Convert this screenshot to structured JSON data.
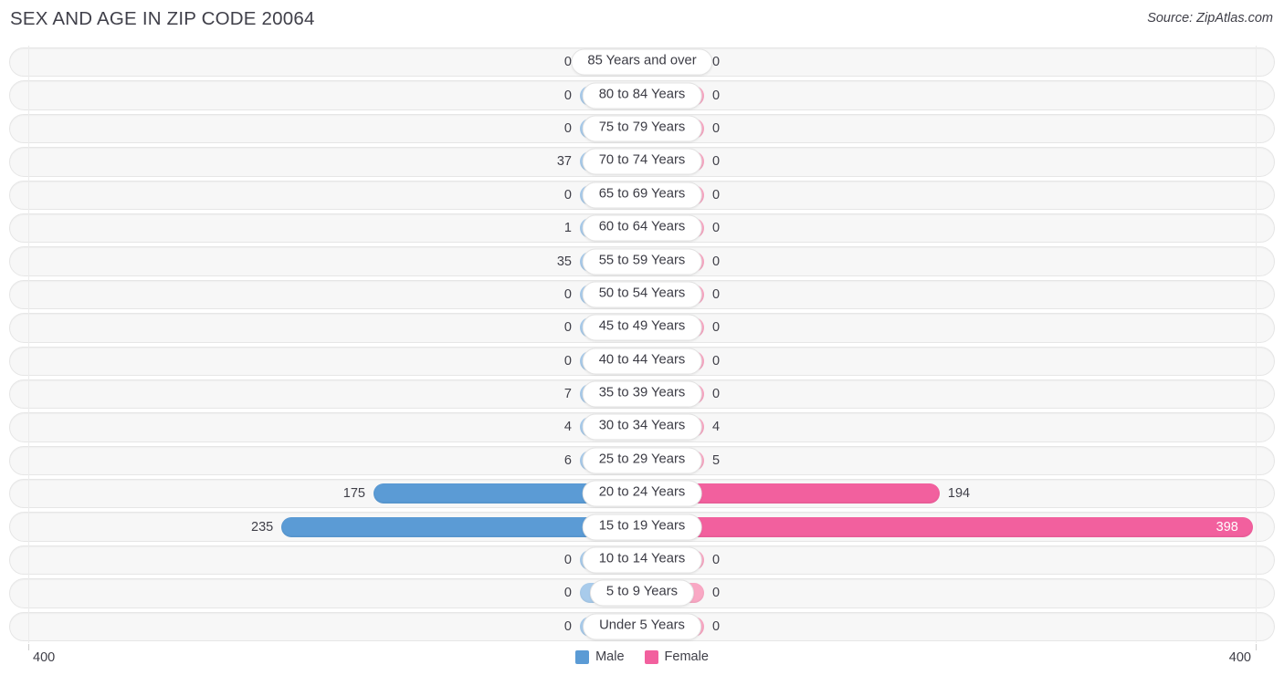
{
  "header": {
    "title": "SEX AND AGE IN ZIP CODE 20064",
    "source": "Source: ZipAtlas.com"
  },
  "legend": {
    "male_label": "Male",
    "female_label": "Female",
    "male_color": "#5b9bd5",
    "female_color": "#f2609e",
    "male_light_color": "#a8cbeb",
    "female_light_color": "#f9a8c4"
  },
  "axis": {
    "left_label": "400",
    "right_label": "400"
  },
  "chart_data": {
    "type": "bar",
    "title": "SEX AND AGE IN ZIP CODE 20064",
    "subtitle": "Source: ZipAtlas.com",
    "orientation": "horizontal",
    "layout": "population-pyramid",
    "xlabel": "",
    "ylabel": "",
    "xlim": [
      400,
      400
    ],
    "axis_max": 400,
    "grid": false,
    "legend_position": "bottom-center",
    "categories": [
      "85 Years and over",
      "80 to 84 Years",
      "75 to 79 Years",
      "70 to 74 Years",
      "65 to 69 Years",
      "60 to 64 Years",
      "55 to 59 Years",
      "50 to 54 Years",
      "45 to 49 Years",
      "40 to 44 Years",
      "35 to 39 Years",
      "30 to 34 Years",
      "25 to 29 Years",
      "20 to 24 Years",
      "15 to 19 Years",
      "10 to 14 Years",
      "5 to 9 Years",
      "Under 5 Years"
    ],
    "series": [
      {
        "name": "Male",
        "values": [
          0,
          0,
          0,
          37,
          0,
          1,
          35,
          0,
          0,
          0,
          7,
          4,
          6,
          175,
          235,
          0,
          0,
          0
        ]
      },
      {
        "name": "Female",
        "values": [
          0,
          0,
          0,
          0,
          0,
          0,
          0,
          0,
          0,
          0,
          0,
          4,
          5,
          194,
          398,
          0,
          0,
          0
        ]
      }
    ]
  },
  "rows": [
    {
      "label": "85 Years and over",
      "male": "0",
      "female": "0"
    },
    {
      "label": "80 to 84 Years",
      "male": "0",
      "female": "0"
    },
    {
      "label": "75 to 79 Years",
      "male": "0",
      "female": "0"
    },
    {
      "label": "70 to 74 Years",
      "male": "37",
      "female": "0"
    },
    {
      "label": "65 to 69 Years",
      "male": "0",
      "female": "0"
    },
    {
      "label": "60 to 64 Years",
      "male": "1",
      "female": "0"
    },
    {
      "label": "55 to 59 Years",
      "male": "35",
      "female": "0"
    },
    {
      "label": "50 to 54 Years",
      "male": "0",
      "female": "0"
    },
    {
      "label": "45 to 49 Years",
      "male": "0",
      "female": "0"
    },
    {
      "label": "40 to 44 Years",
      "male": "0",
      "female": "0"
    },
    {
      "label": "35 to 39 Years",
      "male": "7",
      "female": "0"
    },
    {
      "label": "30 to 34 Years",
      "male": "4",
      "female": "4"
    },
    {
      "label": "25 to 29 Years",
      "male": "6",
      "female": "5"
    },
    {
      "label": "20 to 24 Years",
      "male": "175",
      "female": "194"
    },
    {
      "label": "15 to 19 Years",
      "male": "235",
      "female": "398"
    },
    {
      "label": "10 to 14 Years",
      "male": "0",
      "female": "0"
    },
    {
      "label": "5 to 9 Years",
      "male": "0",
      "female": "0"
    },
    {
      "label": "Under 5 Years",
      "male": "0",
      "female": "0"
    }
  ]
}
